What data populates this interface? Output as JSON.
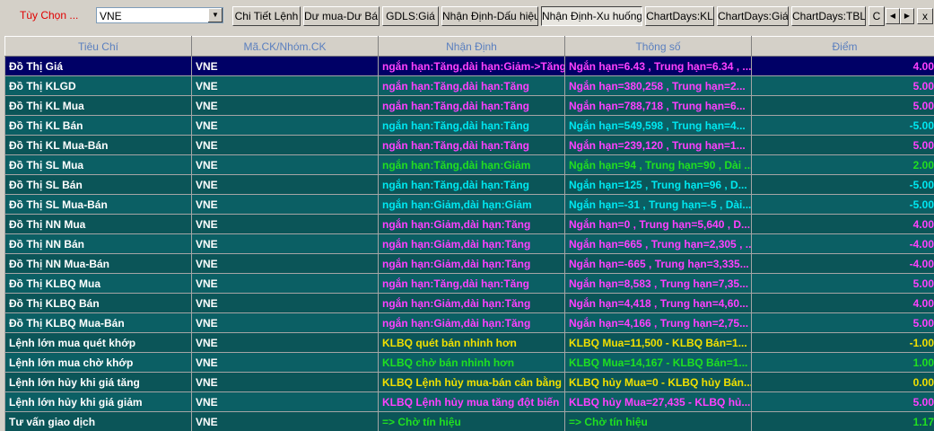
{
  "toolbar": {
    "option_label": "Tùy Chọn ...",
    "symbol_value": "VNE",
    "buttons": [
      "Chi Tiết Lệnh",
      "Dư mua-Dư Bán",
      "GDLS:Giá",
      "Nhận Định-Dấu hiệu",
      "Nhận Định-Xu huống",
      "ChartDays:KL",
      "ChartDays:Giá",
      "ChartDays:TBL",
      "C"
    ],
    "close_label": "x"
  },
  "table": {
    "headers": [
      "Tiêu Chí",
      "Mã.CK/Nhóm.CK",
      "Nhận Định",
      "Thông số",
      "Điểm"
    ],
    "rows": [
      {
        "criteria": "Đồ Thị Giá",
        "symbol": "VNE",
        "assessment": "ngắn hạn:Tăng,dài hạn:Giảm->Tăng",
        "params": "Ngắn hạn=6.43 , Trung hạn=6.34 , ...",
        "score": "4.00",
        "a_color": "#ff40ff",
        "p_color": "#ff40ff",
        "s_color": "#ff40ff"
      },
      {
        "criteria": "Đồ Thị KLGD",
        "symbol": "VNE",
        "assessment": "ngắn hạn:Tăng,dài hạn:Tăng",
        "params": "Ngắn hạn=380,258 , Trung hạn=2...",
        "score": "5.00",
        "a_color": "#ff40ff",
        "p_color": "#ff40ff",
        "s_color": "#ff40ff"
      },
      {
        "criteria": "Đồ Thị KL Mua",
        "symbol": "VNE",
        "assessment": "ngắn hạn:Tăng,dài hạn:Tăng",
        "params": "Ngắn hạn=788,718 , Trung hạn=6...",
        "score": "5.00",
        "a_color": "#ff40ff",
        "p_color": "#ff40ff",
        "s_color": "#ff40ff"
      },
      {
        "criteria": "Đồ Thị KL Bán",
        "symbol": "VNE",
        "assessment": "ngắn hạn:Tăng,dài hạn:Tăng",
        "params": "Ngắn hạn=549,598 , Trung hạn=4...",
        "score": "-5.00",
        "a_color": "#00e8f0",
        "p_color": "#00e8f0",
        "s_color": "#00e8f0"
      },
      {
        "criteria": "Đồ Thị KL Mua-Bán",
        "symbol": "VNE",
        "assessment": "ngắn hạn:Tăng,dài hạn:Tăng",
        "params": "Ngắn hạn=239,120 , Trung hạn=1...",
        "score": "5.00",
        "a_color": "#ff40ff",
        "p_color": "#ff40ff",
        "s_color": "#ff40ff"
      },
      {
        "criteria": "Đồ Thị SL Mua",
        "symbol": "VNE",
        "assessment": "ngắn hạn:Tăng,dài hạn:Giảm",
        "params": "Ngắn hạn=94 , Trung hạn=90 , Dài ...",
        "score": "2.00",
        "a_color": "#20e020",
        "p_color": "#20e020",
        "s_color": "#20e020"
      },
      {
        "criteria": "Đồ Thị SL Bán",
        "symbol": "VNE",
        "assessment": "ngắn hạn:Tăng,dài hạn:Tăng",
        "params": "Ngắn hạn=125 , Trung hạn=96 , D...",
        "score": "-5.00",
        "a_color": "#00e8f0",
        "p_color": "#00e8f0",
        "s_color": "#00e8f0"
      },
      {
        "criteria": "Đồ Thị SL Mua-Bán",
        "symbol": "VNE",
        "assessment": "ngắn hạn:Giảm,dài hạn:Giảm",
        "params": "Ngắn hạn=-31 , Trung hạn=-5 , Dài...",
        "score": "-5.00",
        "a_color": "#00e8f0",
        "p_color": "#00e8f0",
        "s_color": "#00e8f0"
      },
      {
        "criteria": "Đồ Thị NN Mua",
        "symbol": "VNE",
        "assessment": "ngắn hạn:Giảm,dài hạn:Tăng",
        "params": "Ngắn hạn=0 , Trung hạn=5,640 , D...",
        "score": "4.00",
        "a_color": "#ff40ff",
        "p_color": "#ff40ff",
        "s_color": "#ff40ff"
      },
      {
        "criteria": "Đồ Thị NN Bán",
        "symbol": "VNE",
        "assessment": "ngắn hạn:Giảm,dài hạn:Tăng",
        "params": "Ngắn hạn=665 , Trung hạn=2,305 , ...",
        "score": "-4.00",
        "a_color": "#ff40ff",
        "p_color": "#ff40ff",
        "s_color": "#ff40ff"
      },
      {
        "criteria": "Đồ Thị NN Mua-Bán",
        "symbol": "VNE",
        "assessment": "ngắn hạn:Giảm,dài hạn:Tăng",
        "params": "Ngắn hạn=-665 , Trung hạn=3,335...",
        "score": "-4.00",
        "a_color": "#ff40ff",
        "p_color": "#ff40ff",
        "s_color": "#ff40ff"
      },
      {
        "criteria": "Đồ Thị KLBQ Mua",
        "symbol": "VNE",
        "assessment": "ngắn hạn:Tăng,dài hạn:Tăng",
        "params": "Ngắn hạn=8,583 , Trung hạn=7,35...",
        "score": "5.00",
        "a_color": "#ff40ff",
        "p_color": "#ff40ff",
        "s_color": "#ff40ff"
      },
      {
        "criteria": "Đồ Thị KLBQ Bán",
        "symbol": "VNE",
        "assessment": "ngắn hạn:Giảm,dài hạn:Tăng",
        "params": "Ngắn hạn=4,418 , Trung hạn=4,60...",
        "score": "4.00",
        "a_color": "#ff40ff",
        "p_color": "#ff40ff",
        "s_color": "#ff40ff"
      },
      {
        "criteria": "Đồ Thị KLBQ Mua-Bán",
        "symbol": "VNE",
        "assessment": "ngắn hạn:Giảm,dài hạn:Tăng",
        "params": "Ngắn hạn=4,166 , Trung hạn=2,75...",
        "score": "5.00",
        "a_color": "#ff40ff",
        "p_color": "#ff40ff",
        "s_color": "#ff40ff"
      },
      {
        "criteria": "Lệnh lớn mua quét khớp",
        "symbol": "VNE",
        "assessment": "KLBQ quét bán nhỉnh hơn",
        "params": "KLBQ Mua=11,500 - KLBQ Bán=1...",
        "score": "-1.00",
        "a_color": "#f0e000",
        "p_color": "#f0e000",
        "s_color": "#f0e000"
      },
      {
        "criteria": "Lệnh lớn mua chờ khớp",
        "symbol": "VNE",
        "assessment": "KLBQ chờ bán nhỉnh hơn",
        "params": "KLBQ Mua=14,167 - KLBQ Bán=1...",
        "score": "1.00",
        "a_color": "#20e020",
        "p_color": "#20e020",
        "s_color": "#20e020"
      },
      {
        "criteria": "Lệnh lớn hủy khi giá tăng",
        "symbol": "VNE",
        "assessment": "KLBQ Lệnh hủy mua-bán cân bằng",
        "params": "KLBQ hủy Mua=0 - KLBQ hủy Bán...",
        "score": "0.00",
        "a_color": "#f0e000",
        "p_color": "#f0e000",
        "s_color": "#f0e000"
      },
      {
        "criteria": "Lệnh lớn hủy khi giá giảm",
        "symbol": "VNE",
        "assessment": "KLBQ Lệnh hủy mua tăng đột biến",
        "params": "KLBQ hủy Mua=27,435 - KLBQ hủ...",
        "score": "5.00",
        "a_color": "#ff40ff",
        "p_color": "#ff40ff",
        "s_color": "#ff40ff"
      },
      {
        "criteria": "Tư vấn giao dịch",
        "symbol": "VNE",
        "assessment": "=> Chờ tín hiệu",
        "params": "=> Chờ tín hiệu",
        "score": "1.17",
        "a_color": "#20e020",
        "p_color": "#20e020",
        "s_color": "#20e020"
      }
    ]
  }
}
